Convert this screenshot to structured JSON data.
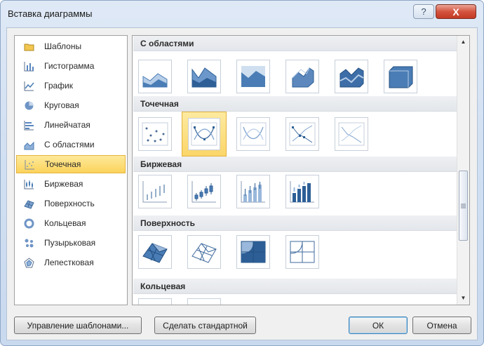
{
  "window": {
    "title": "Вставка диаграммы",
    "help_label": "?",
    "close_label": "X"
  },
  "categories": [
    {
      "label": "Шаблоны",
      "icon": "folder-icon"
    },
    {
      "label": "Гистограмма",
      "icon": "column-chart-icon"
    },
    {
      "label": "График",
      "icon": "line-chart-icon"
    },
    {
      "label": "Круговая",
      "icon": "pie-chart-icon"
    },
    {
      "label": "Линейчатая",
      "icon": "bar-chart-icon"
    },
    {
      "label": "С областями",
      "icon": "area-chart-icon"
    },
    {
      "label": "Точечная",
      "icon": "scatter-chart-icon",
      "selected": true
    },
    {
      "label": "Биржевая",
      "icon": "stock-chart-icon"
    },
    {
      "label": "Поверхность",
      "icon": "surface-chart-icon"
    },
    {
      "label": "Кольцевая",
      "icon": "doughnut-chart-icon"
    },
    {
      "label": "Пузырьковая",
      "icon": "bubble-chart-icon"
    },
    {
      "label": "Лепестковая",
      "icon": "radar-chart-icon"
    }
  ],
  "sections": {
    "area": "С областями",
    "scatter": "Точечная",
    "stock": "Биржевая",
    "surface": "Поверхность",
    "doughnut": "Кольцевая"
  },
  "buttons": {
    "manage_templates": "Управление шаблонами...",
    "set_default": "Сделать стандартной",
    "ok": "ОК",
    "cancel": "Отмена"
  },
  "colors": {
    "selection": "#fbd35c",
    "chart_blue": "#4a7db5",
    "chart_light_blue": "#9ab8db"
  }
}
